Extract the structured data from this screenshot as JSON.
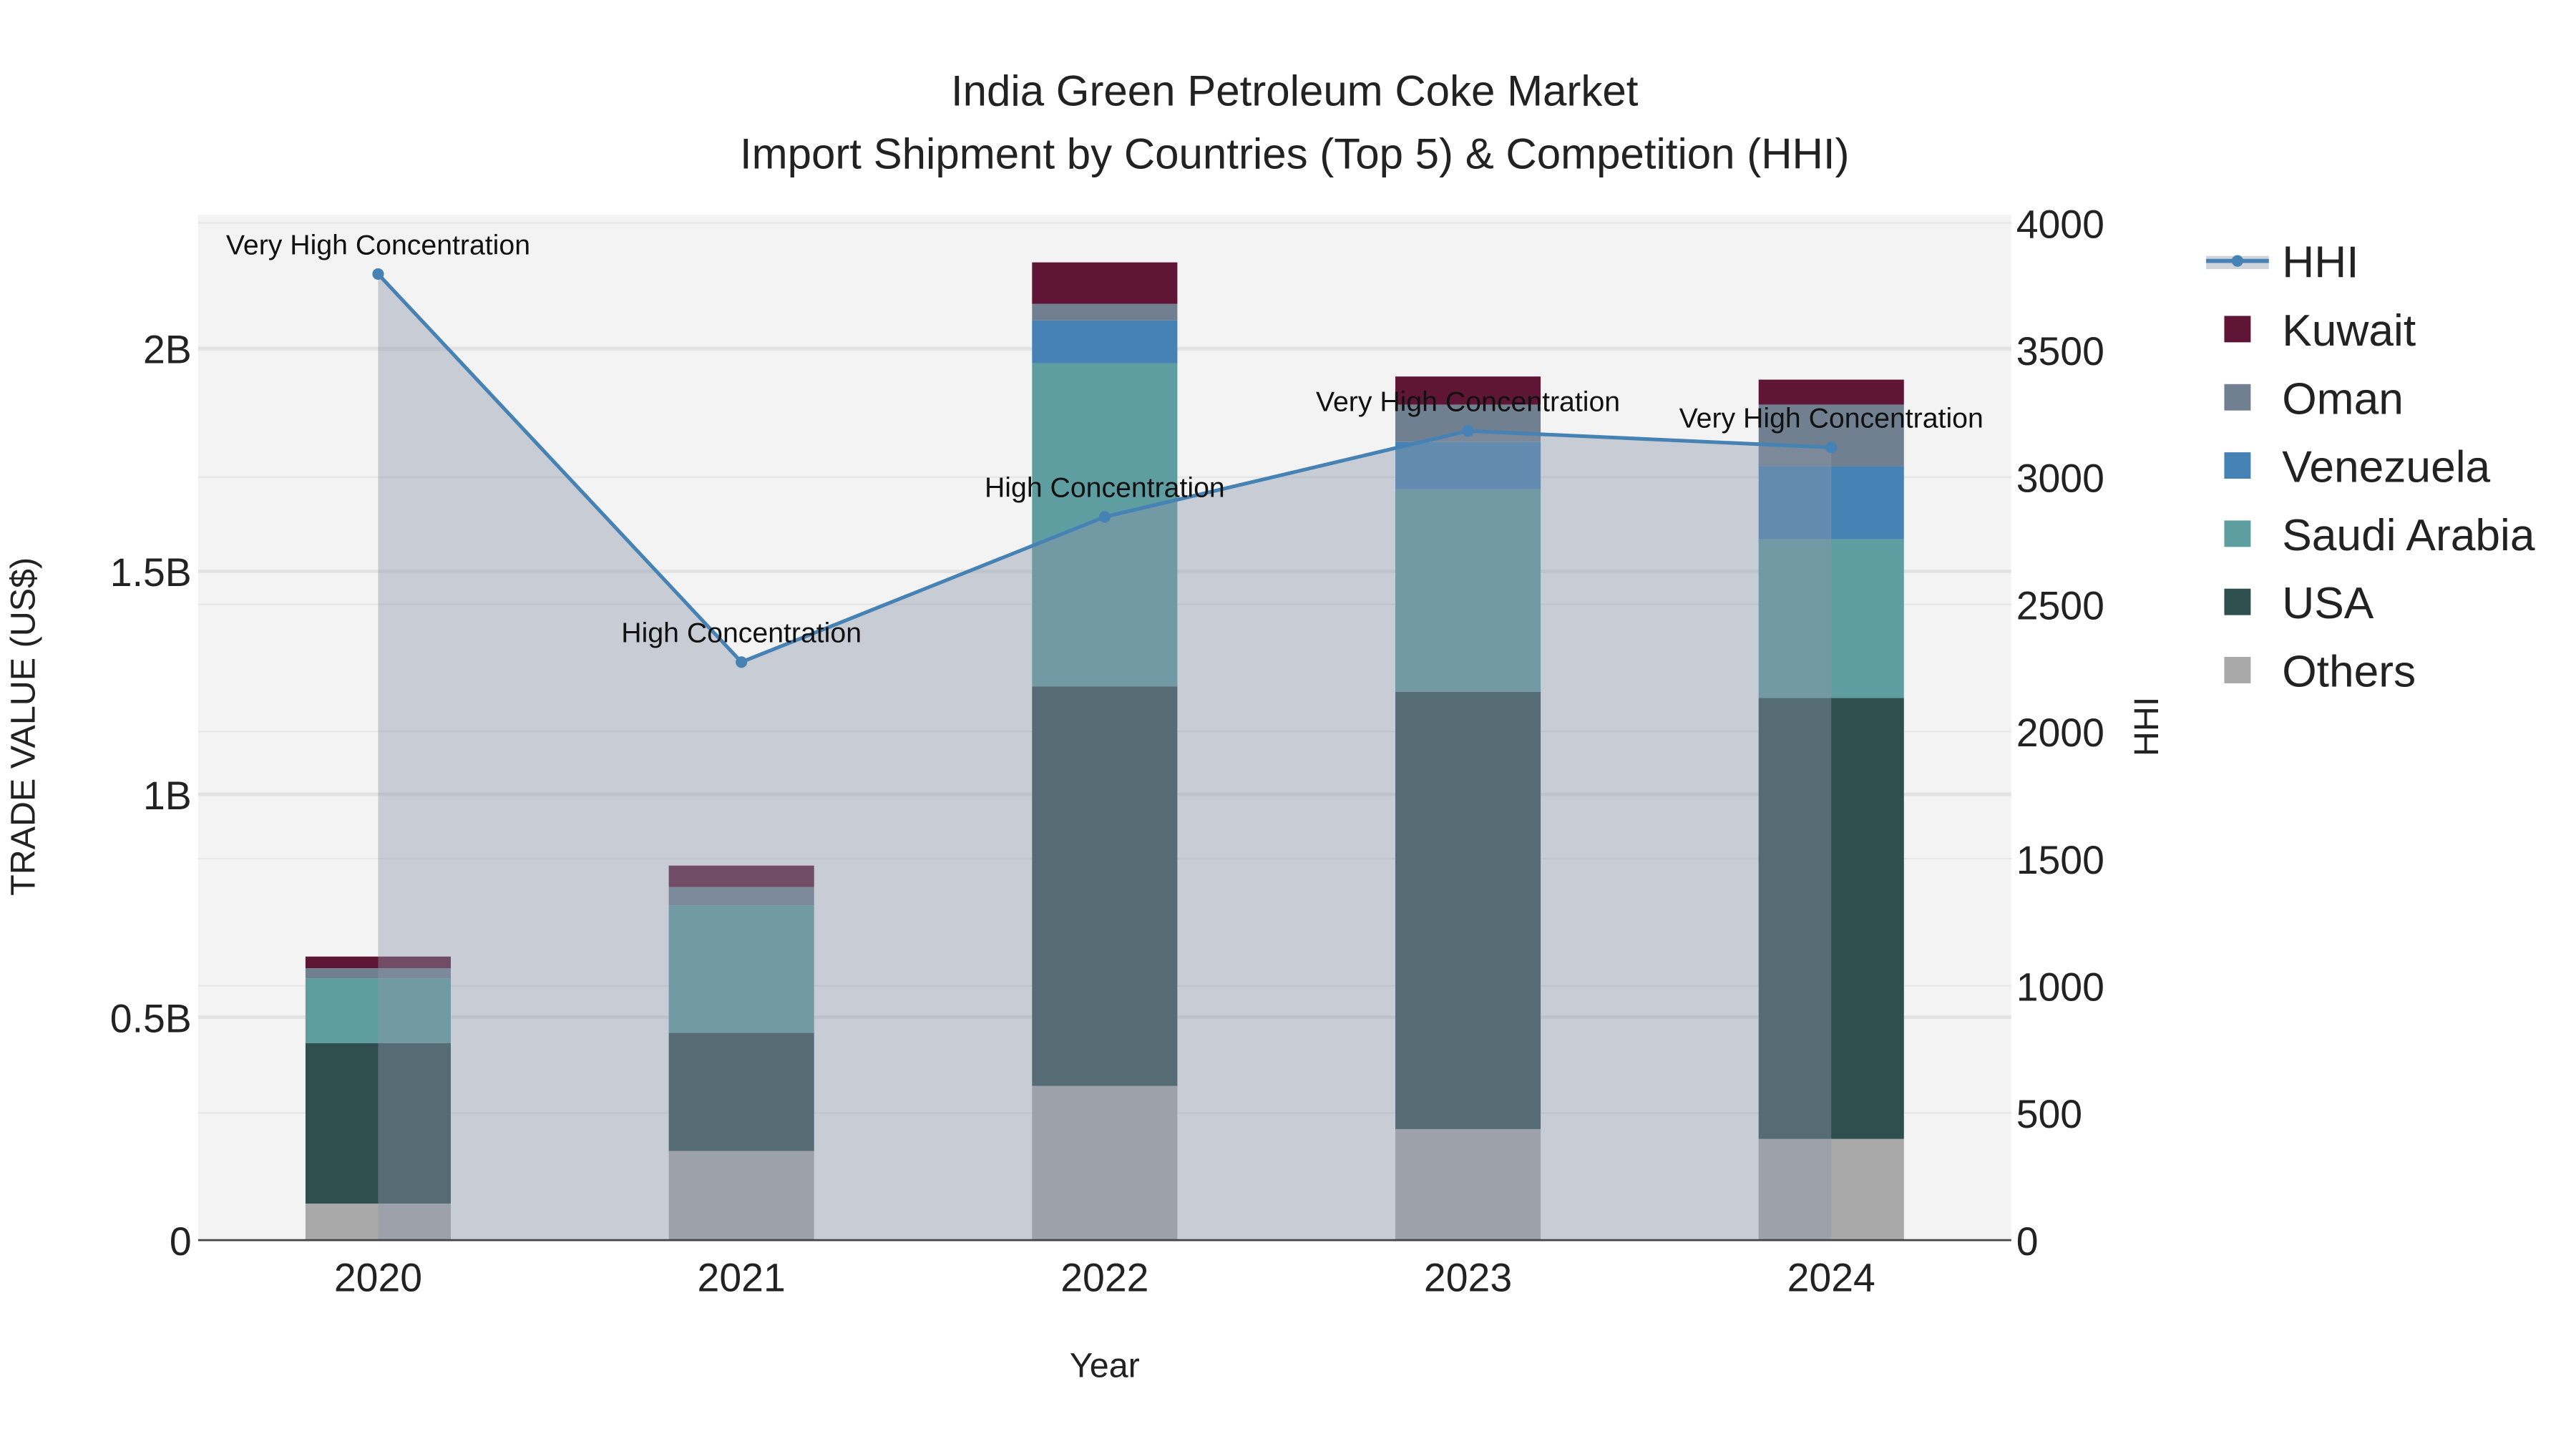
{
  "chart_data": {
    "type": "bar",
    "barmode": "stack",
    "title": "India Green Petroleum Coke Market",
    "subtitle": "Import Shipment by Countries (Top 5) & Competition (HHI)",
    "xlabel": "Year",
    "ylabel": "TRADE VALUE (US$)",
    "y2label": "HHI",
    "categories": [
      "2020",
      "2021",
      "2022",
      "2023",
      "2024"
    ],
    "ylim": [
      0,
      2.3
    ],
    "yticks": [
      {
        "v": 0,
        "label": "0"
      },
      {
        "v": 0.5,
        "label": "0.5B"
      },
      {
        "v": 1,
        "label": "1B"
      },
      {
        "v": 1.5,
        "label": "1.5B"
      },
      {
        "v": 2,
        "label": "2B"
      }
    ],
    "y2lim": [
      0,
      4000
    ],
    "y2ticks": [
      "0",
      "500",
      "1000",
      "1500",
      "2000",
      "2500",
      "3000",
      "3500",
      "4000"
    ],
    "series": [
      {
        "name": "Others",
        "color": "#a9a9a9",
        "values": [
          0.082,
          0.2,
          0.346,
          0.249,
          0.227
        ]
      },
      {
        "name": "USA",
        "color": "#2f4f4f",
        "values": [
          0.36,
          0.265,
          0.896,
          0.981,
          0.989
        ]
      },
      {
        "name": "Saudi Arabia",
        "color": "#5f9ea0",
        "values": [
          0.145,
          0.286,
          0.725,
          0.454,
          0.356
        ]
      },
      {
        "name": "Venezuela",
        "color": "#4682b4",
        "values": [
          0.0,
          0.0,
          0.096,
          0.106,
          0.164
        ]
      },
      {
        "name": "Oman",
        "color": "#708090",
        "values": [
          0.023,
          0.041,
          0.037,
          0.084,
          0.138
        ]
      },
      {
        "name": "Kuwait",
        "color": "#5f1535",
        "values": [
          0.026,
          0.048,
          0.093,
          0.063,
          0.056
        ]
      }
    ],
    "hhi": {
      "name": "HHI",
      "color": "#4682b4",
      "values": [
        3799,
        2273,
        2844,
        3182,
        3117
      ],
      "annotations": [
        "Very High Concentration",
        "High Concentration",
        "High Concentration",
        "Very High Concentration",
        "Very High Concentration"
      ]
    },
    "legend": [
      "HHI",
      "Kuwait",
      "Oman",
      "Venezuela",
      "Saudi Arabia",
      "USA",
      "Others"
    ],
    "legend_position": "right",
    "grid": true
  }
}
